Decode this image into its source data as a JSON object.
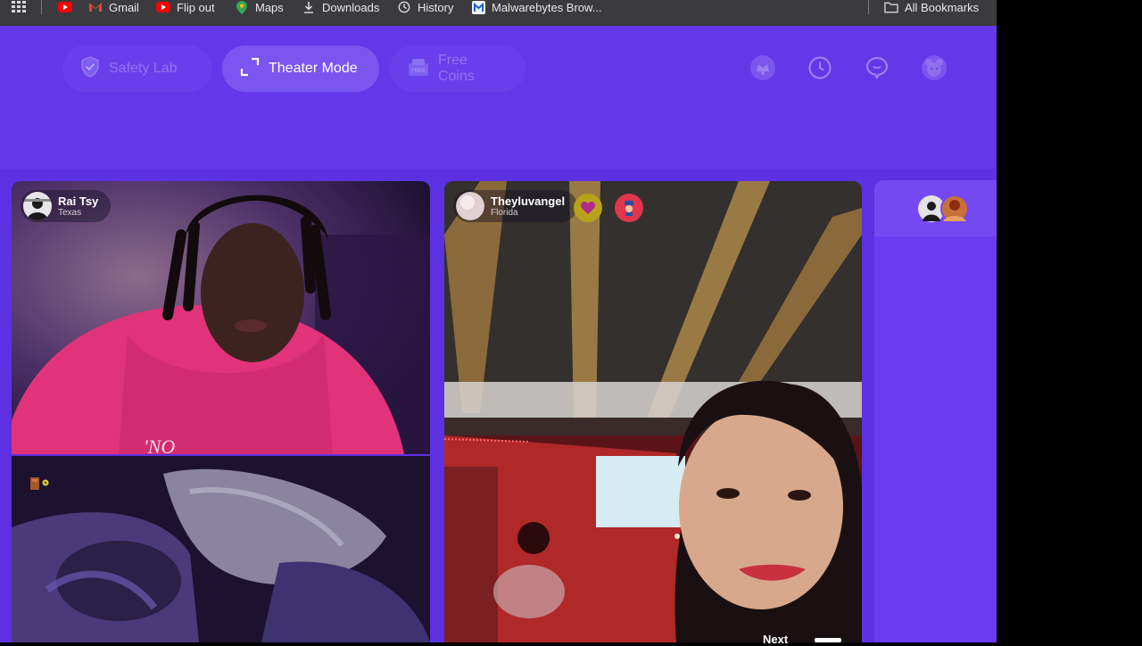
{
  "bookmarks_bar": {
    "items": [
      {
        "label": "Gmail",
        "icon": "gmail-icon"
      },
      {
        "label": "Flip out",
        "icon": "youtube-icon"
      },
      {
        "label": "Maps",
        "icon": "maps-pin-icon"
      },
      {
        "label": "Downloads",
        "icon": "download-icon"
      },
      {
        "label": "History",
        "icon": "history-icon"
      },
      {
        "label": "Malwarebytes Brow...",
        "icon": "malwarebytes-icon"
      }
    ],
    "all_bookmarks": "All Bookmarks"
  },
  "toolbar": {
    "safety_lab": "Safety Lab",
    "theater_mode": "Theater Mode",
    "free_coins": "Free Coins"
  },
  "tiles": {
    "tile1": {
      "name": "Rai Tsy",
      "location": "Texas",
      "shirt_text": "'NO"
    },
    "tile3": {
      "name": "Theyluvangel",
      "location": "Florida"
    }
  },
  "next_label": "Next",
  "colors": {
    "accent": "#6134e6",
    "active_pill": "#7b55f0",
    "bookmark_bar": "#3b3b3f"
  }
}
